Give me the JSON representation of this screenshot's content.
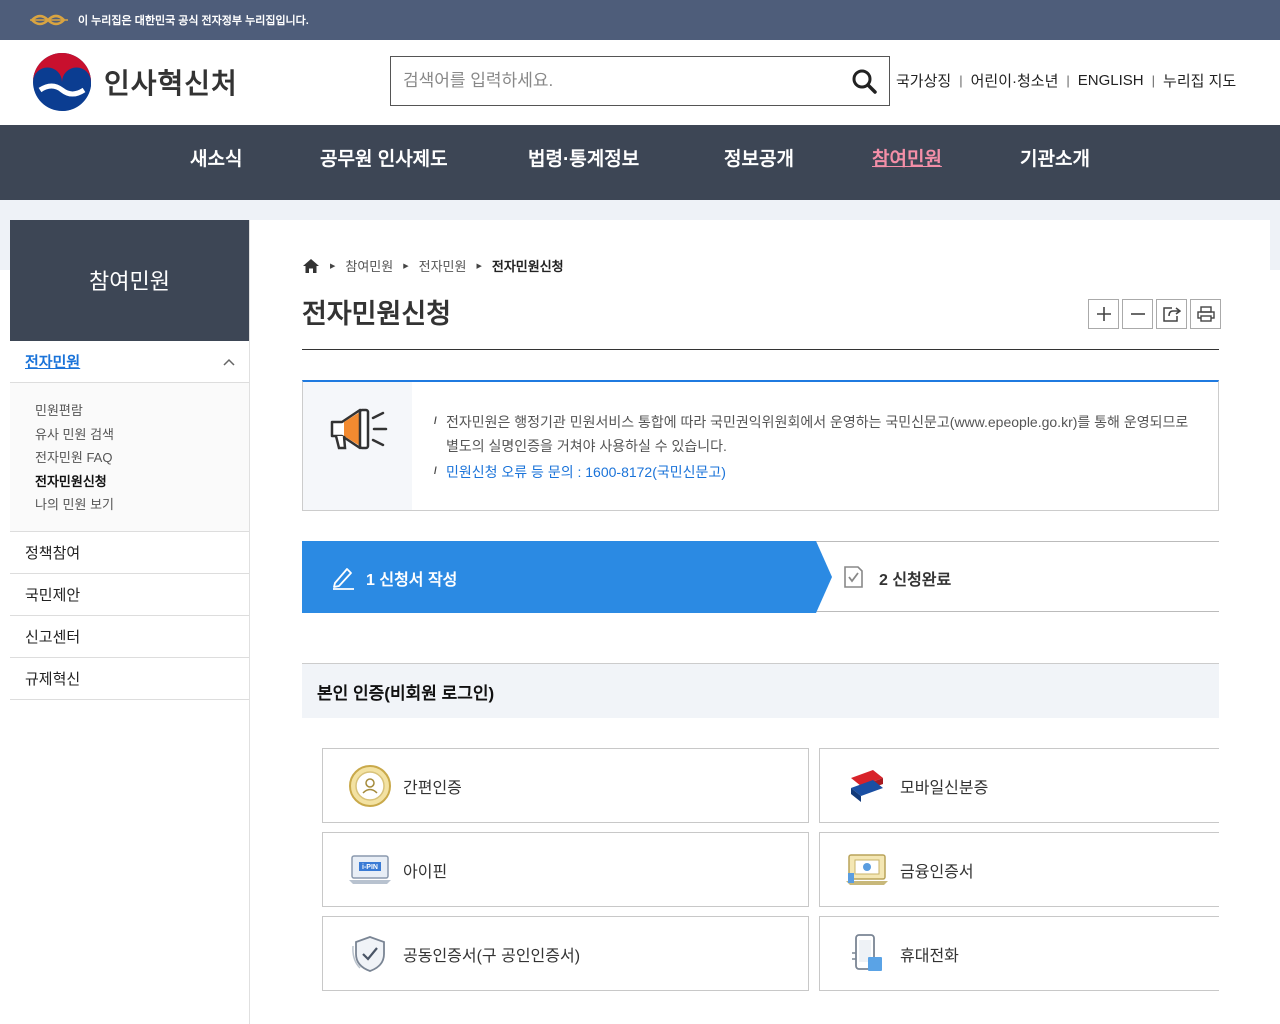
{
  "gov_banner": {
    "text": "이 누리집은 대한민국 공식 전자정부 누리집입니다."
  },
  "header": {
    "logo_text": "인사혁신처",
    "search_placeholder": "검색어를 입력하세요.",
    "util_links": [
      "국가상징",
      "어린이·청소년",
      "ENGLISH",
      "누리집 지도"
    ]
  },
  "gnb": {
    "items": [
      {
        "label": "새소식"
      },
      {
        "label": "공무원 인사제도"
      },
      {
        "label": "법령·통계정보"
      },
      {
        "label": "정보공개"
      },
      {
        "label": "참여민원"
      },
      {
        "label": "기관소개"
      }
    ],
    "active_index": 4
  },
  "lnb": {
    "title": "참여민원",
    "active_section": "전자민원",
    "sub_items": [
      "민원편람",
      "유사 민원 검색",
      "전자민원 FAQ",
      "전자민원신청",
      "나의 민원 보기"
    ],
    "current_sub": "전자민원신청",
    "items": [
      "정책참여",
      "국민제안",
      "신고센터",
      "규제혁신"
    ]
  },
  "breadcrumb": [
    "참여민원",
    "전자민원",
    "전자민원신청"
  ],
  "page_title": "전자민원신청",
  "notice": {
    "line1": "전자민원은 행정기관 민원서비스 통합에 따라 국민권익위원회에서 운영하는 국민신문고(www.epeople.go.kr)를 통해 운영되므로 별도의 실명인증을 거쳐야 사용하실 수 있습니다.",
    "line2": "민원신청 오류 등 문의 : 1600-8172(국민신문고)"
  },
  "steps": [
    {
      "label": "1 신청서 작성",
      "active": true
    },
    {
      "label": "2 신청완료",
      "active": false
    }
  ],
  "auth": {
    "title": "본인 인증(비회원 로그인)",
    "methods": [
      {
        "label": "간편인증",
        "icon": "simple-auth-icon"
      },
      {
        "label": "모바일신분증",
        "icon": "mobile-id-icon"
      },
      {
        "label": "아이핀",
        "icon": "ipin-icon"
      },
      {
        "label": "금융인증서",
        "icon": "financial-cert-icon"
      },
      {
        "label": "공동인증서(구 공인인증서)",
        "icon": "joint-cert-icon"
      },
      {
        "label": "휴대전화",
        "icon": "mobile-phone-icon"
      }
    ]
  },
  "colors": {
    "nav_bg": "#3d4655",
    "accent_blue": "#1f7ae0",
    "active_nav": "#f48fa8",
    "banner_bg": "#4e5d7a"
  }
}
